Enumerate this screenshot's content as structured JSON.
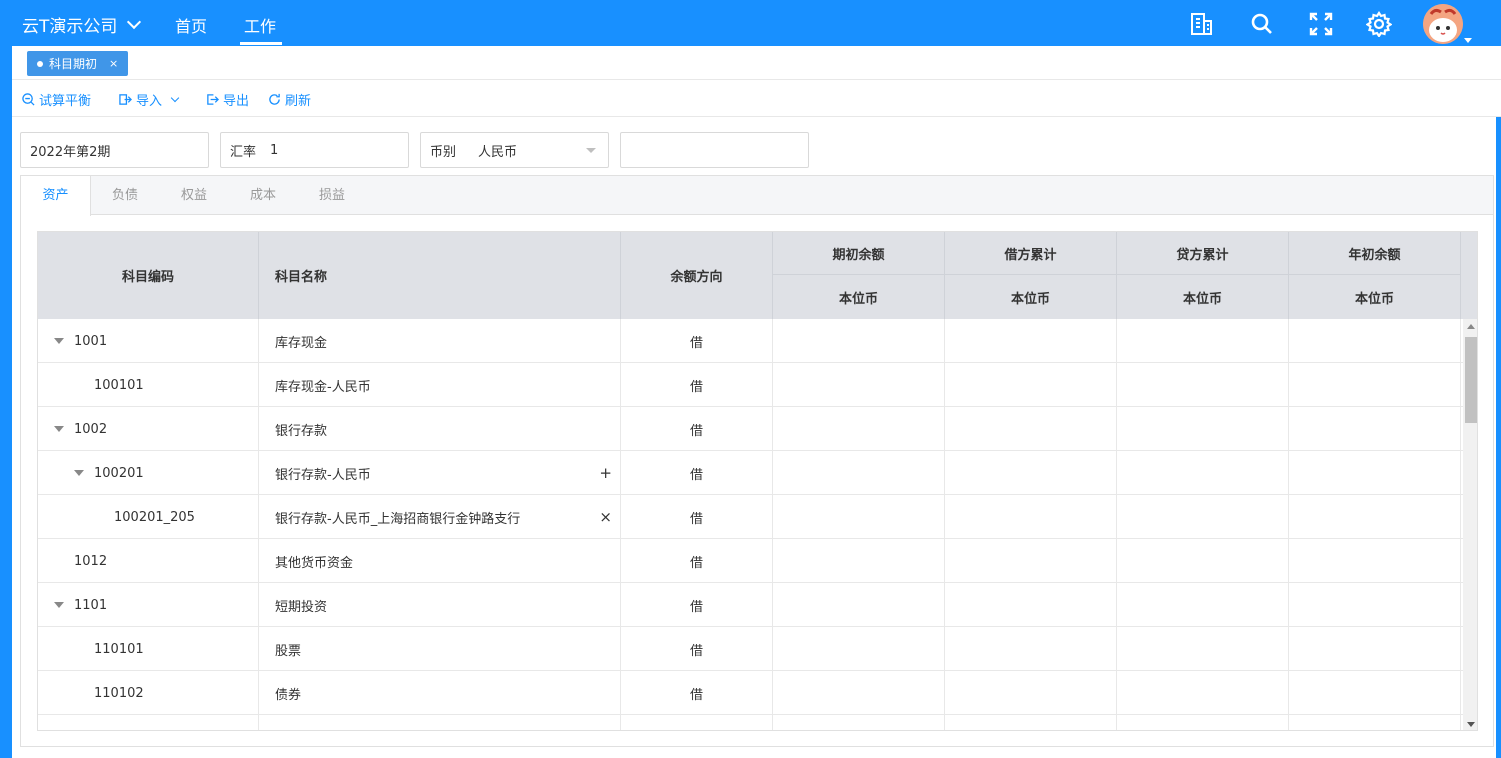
{
  "header": {
    "company": "云T演示公司",
    "nav": [
      "首页",
      "工作"
    ],
    "icons": [
      "building-icon",
      "search-icon",
      "expand-icon",
      "gear-icon"
    ]
  },
  "page_tab": {
    "label": "科目期初",
    "close": "×"
  },
  "toolbar": {
    "trial_balance": "试算平衡",
    "import": "导入",
    "export": "导出",
    "refresh": "刷新"
  },
  "filters": {
    "period": "2022年第2期",
    "rate_label": "汇率",
    "rate_value": "1",
    "currency_label": "币别",
    "currency_value": "人民币",
    "extra": ""
  },
  "tabs": [
    "资产",
    "负债",
    "权益",
    "成本",
    "损益"
  ],
  "table": {
    "headers": {
      "code": "科目编码",
      "name": "科目名称",
      "direction": "余额方向",
      "groups": [
        "期初余额",
        "借方累计",
        "贷方累计",
        "年初余额"
      ],
      "sub": "本位币"
    },
    "rows": [
      {
        "code": "1001",
        "name": "库存现金",
        "dir": "借",
        "level": 0,
        "expand": true,
        "action": ""
      },
      {
        "code": "100101",
        "name": "库存现金-人民币",
        "dir": "借",
        "level": 1,
        "expand": false,
        "action": ""
      },
      {
        "code": "1002",
        "name": "银行存款",
        "dir": "借",
        "level": 0,
        "expand": true,
        "action": ""
      },
      {
        "code": "100201",
        "name": "银行存款-人民币",
        "dir": "借",
        "level": 1,
        "expand": true,
        "action": "+"
      },
      {
        "code": "100201_205",
        "name": "银行存款-人民币_上海招商银行金钟路支行",
        "dir": "借",
        "level": 2,
        "expand": false,
        "action": "×"
      },
      {
        "code": "1012",
        "name": "其他货币资金",
        "dir": "借",
        "level": 0,
        "expand": false,
        "action": ""
      },
      {
        "code": "1101",
        "name": "短期投资",
        "dir": "借",
        "level": 0,
        "expand": true,
        "action": ""
      },
      {
        "code": "110101",
        "name": "股票",
        "dir": "借",
        "level": 1,
        "expand": false,
        "action": ""
      },
      {
        "code": "110102",
        "name": "债券",
        "dir": "借",
        "level": 1,
        "expand": false,
        "action": ""
      },
      {
        "code": "",
        "name": "",
        "dir": "",
        "level": 0,
        "expand": false,
        "action": ""
      }
    ]
  },
  "colors": {
    "primary": "#1890ff",
    "header_bg": "#dfe1e6"
  }
}
